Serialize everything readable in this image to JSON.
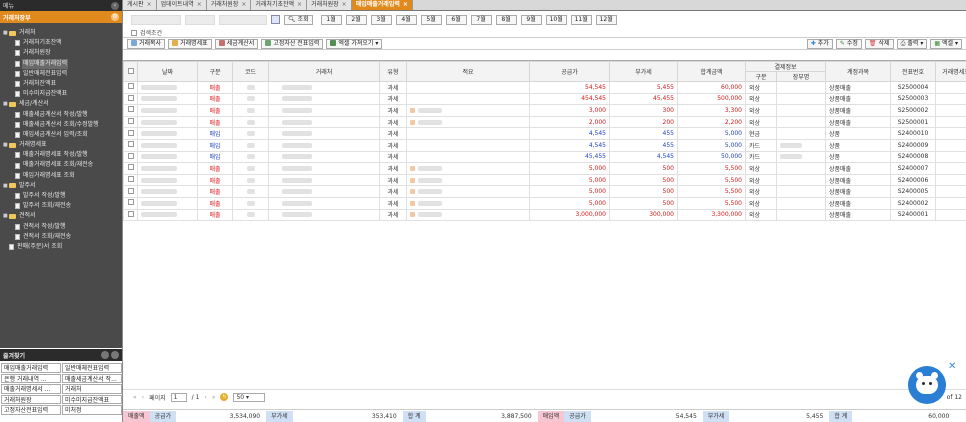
{
  "left": {
    "top_label": "메뉴",
    "header": "거래처장부",
    "tree": [
      {
        "label": "거래처",
        "level": 0,
        "folder": true
      },
      {
        "label": "거래처기초잔액",
        "level": 1
      },
      {
        "label": "거래처원장",
        "level": 1
      },
      {
        "label": "매입매출거래입력",
        "level": 1,
        "selected": true
      },
      {
        "label": "일반매체전표입력",
        "level": 1
      },
      {
        "label": "거래처잔액표",
        "level": 1
      },
      {
        "label": "미수미지급잔액표",
        "level": 1
      },
      {
        "label": "세금/계산서",
        "level": 0,
        "folder": true
      },
      {
        "label": "매출세금계산서 작성/발행",
        "level": 1
      },
      {
        "label": "매출세금계산서 조회/수정발행",
        "level": 1
      },
      {
        "label": "매입세금계산서 입력/조회",
        "level": 1
      },
      {
        "label": "거래명세표",
        "level": 0,
        "folder": true
      },
      {
        "label": "매출거래명세표 작성/발행",
        "level": 1
      },
      {
        "label": "매출거래명세표 조회/재전송",
        "level": 1
      },
      {
        "label": "매입거래명세표 조회",
        "level": 1
      },
      {
        "label": "발주서",
        "level": 0,
        "folder": true
      },
      {
        "label": "발주서 작성/발행",
        "level": 1
      },
      {
        "label": "발주서 조회/재전송",
        "level": 1
      },
      {
        "label": "견적서",
        "level": 0,
        "folder": true
      },
      {
        "label": "견적서 작성/발행",
        "level": 1
      },
      {
        "label": "견적서 조회/재전송",
        "level": 1
      },
      {
        "label": "판매(주문)서 조회",
        "level": 0,
        "folder": false
      }
    ],
    "fav_title": "즐겨찾기",
    "favorites": [
      "매입매출거래입력",
      "일반매체전표입력",
      "은행 거래내역 ...",
      "매출세금계산서 작...",
      "매출거래명세서 ...",
      "거래처",
      "거래처원장",
      "미수미지급잔액표",
      "고정자산전표입력",
      "미처정"
    ]
  },
  "tabs": [
    {
      "label": "게시판"
    },
    {
      "label": "업데이트내역"
    },
    {
      "label": "거래처원장"
    },
    {
      "label": "거래처기초잔액"
    },
    {
      "label": "거래처원장"
    },
    {
      "label": "매입매출거래입력",
      "active": true
    }
  ],
  "search_btn": "조회",
  "months": [
    "1월",
    "2월",
    "3월",
    "4월",
    "5월",
    "6월",
    "7월",
    "8월",
    "9월",
    "10월",
    "11월",
    "12월"
  ],
  "search_cond": "검색조건",
  "toolbar": {
    "left": [
      "거래복사",
      "거래명세표",
      "세금계산서",
      "고정자산 전표입력",
      "엑셀 가져오기"
    ],
    "right": [
      "추가",
      "수정",
      "삭제",
      "출력",
      "엑셀"
    ]
  },
  "columns": {
    "date": "날짜",
    "type": "구분",
    "code": "코드",
    "partner": "거래처",
    "kind": "유형",
    "memo": "적요",
    "supply": "공급가",
    "vat": "부가세",
    "total": "합계금액",
    "pay_group": "결제정보",
    "pay_type": "구분",
    "pay_acct": "장부명",
    "account": "계정과목",
    "voucher": "전표번호",
    "statement": "거래명세표",
    "evidence": "증빙"
  },
  "rows": [
    {
      "type": "매출",
      "kind": "과세",
      "supply": "54,545",
      "vat": "5,455",
      "total": "60,000",
      "pay": "외상",
      "account": "상품매출",
      "voucher": "S2500004",
      "ev": "",
      "memo": false
    },
    {
      "type": "매출",
      "kind": "과세",
      "supply": "454,545",
      "vat": "45,455",
      "total": "500,000",
      "pay": "외상",
      "account": "상품매출",
      "voucher": "S2500003",
      "ev": "",
      "memo": false
    },
    {
      "type": "매출",
      "kind": "과세",
      "supply": "3,000",
      "vat": "300",
      "total": "3,300",
      "pay": "외상",
      "account": "상품매출",
      "voucher": "S2500002",
      "ev": "",
      "memo": true
    },
    {
      "type": "매출",
      "kind": "과세",
      "supply": "2,000",
      "vat": "200",
      "total": "2,200",
      "pay": "외상",
      "account": "상품매출",
      "voucher": "S2500001",
      "ev": "",
      "memo": true
    },
    {
      "type": "매입",
      "kind": "과세",
      "supply": "4,545",
      "vat": "455",
      "total": "5,000",
      "pay": "현금",
      "account": "상품",
      "voucher": "S2400010",
      "ev": "현영",
      "memo": false
    },
    {
      "type": "매입",
      "kind": "과세",
      "supply": "4,545",
      "vat": "455",
      "total": "5,000",
      "pay": "카드",
      "account": "상품",
      "voucher": "S2400009",
      "ev": "카드",
      "memo": false
    },
    {
      "type": "매입",
      "kind": "과세",
      "supply": "45,455",
      "vat": "4,545",
      "total": "50,000",
      "pay": "카드",
      "account": "상품",
      "voucher": "S2400008",
      "ev": "카드",
      "memo": false
    },
    {
      "type": "매출",
      "kind": "과세",
      "supply": "5,000",
      "vat": "500",
      "total": "5,500",
      "pay": "외상",
      "account": "상품매출",
      "voucher": "S2400007",
      "ev": "",
      "memo": true
    },
    {
      "type": "매출",
      "kind": "과세",
      "supply": "5,000",
      "vat": "500",
      "total": "5,500",
      "pay": "외상",
      "account": "상품매출",
      "voucher": "S2400006",
      "ev": "",
      "memo": true
    },
    {
      "type": "매출",
      "kind": "과세",
      "supply": "5,000",
      "vat": "500",
      "total": "5,500",
      "pay": "외상",
      "account": "상품매출",
      "voucher": "S2400005",
      "ev": "",
      "memo": true
    },
    {
      "type": "매출",
      "kind": "과세",
      "supply": "5,000",
      "vat": "500",
      "total": "5,500",
      "pay": "외상",
      "account": "상품매출",
      "voucher": "S2400002",
      "ev": "",
      "memo": true
    },
    {
      "type": "매출",
      "kind": "과세",
      "supply": "3,000,000",
      "vat": "300,000",
      "total": "3,300,000",
      "pay": "외상",
      "account": "상품매출",
      "voucher": "S2400001",
      "ev": "",
      "memo": true
    }
  ],
  "pager": {
    "page_label": "페이지",
    "page": "1",
    "of": "/ 1",
    "size": "50",
    "count": "of 12"
  },
  "totals": {
    "sales_label": "매출액",
    "supply_label": "공급가",
    "sales_supply": "3,534,090",
    "vat_label": "부가세",
    "sales_vat": "353,410",
    "sum_label": "합 계",
    "sales_total": "3,887,500",
    "purchase_label": "매입액",
    "p_supply_label": "공급가",
    "p_supply": "54,545",
    "p_vat_label": "부가세",
    "p_vat": "5,455",
    "p_sum_label": "합 계",
    "p_total": "60,000"
  },
  "colors": {
    "accent": "#e08a1e",
    "sales_text": "#d61818",
    "purchase_text": "#1e3fc8"
  }
}
